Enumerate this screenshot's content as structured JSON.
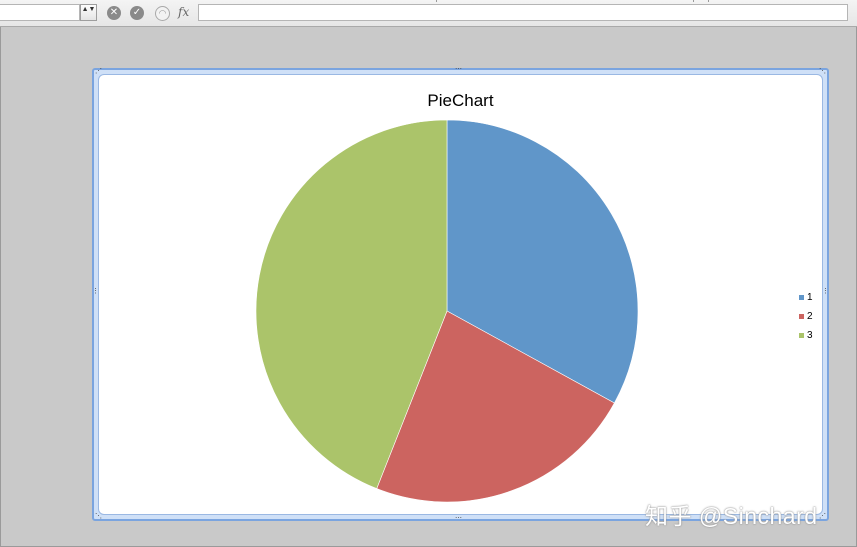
{
  "formula_bar": {
    "name_box_value": "",
    "stepper_glyph": "▲▼",
    "cancel_icon": "x-circle-icon",
    "enter_icon": "check-circle-icon",
    "function_icon": "function-wizard-icon",
    "fx_label": "fx",
    "formula_value": ""
  },
  "chart_data": {
    "type": "pie",
    "title": "PieChart",
    "categories": [
      "1",
      "2",
      "3"
    ],
    "values": [
      33,
      23,
      44
    ],
    "colors": [
      "#6096c9",
      "#cc6460",
      "#abc46a"
    ],
    "start_angle_deg": 0,
    "direction": "clockwise",
    "legend_placement": "right"
  },
  "watermark": "知乎 @Sinchard"
}
